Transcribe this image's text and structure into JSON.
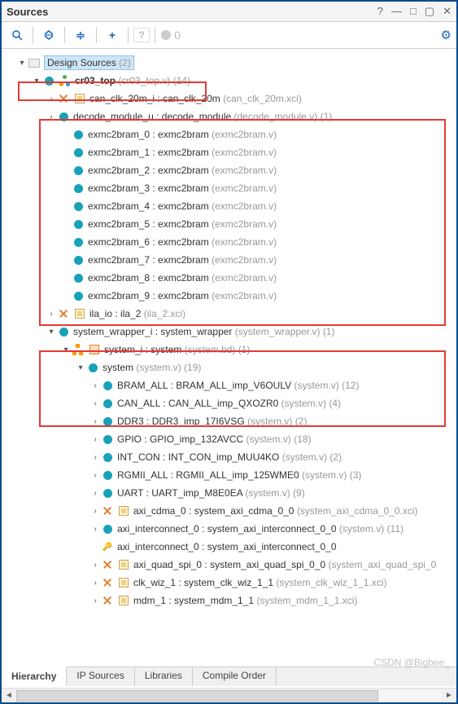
{
  "window": {
    "title": "Sources"
  },
  "toolbar": {
    "counter": "0"
  },
  "root": {
    "label": "Design Sources",
    "count": "(2)"
  },
  "top": {
    "name": "cr03_top",
    "file": "(cr03_top.v)",
    "count": "(14)"
  },
  "can_clk": {
    "inst": "can_clk_20m_i",
    "mod": "can_clk_20m",
    "file": "(can_clk_20m.xci)"
  },
  "decode": {
    "inst": "decode_module_u",
    "mod": "decode_module",
    "file": "(decode_module.v)",
    "count": "(1)"
  },
  "exmc": [
    {
      "inst": "exmc2bram_0",
      "mod": "exmc2bram",
      "file": "(exmc2bram.v)"
    },
    {
      "inst": "exmc2bram_1",
      "mod": "exmc2bram",
      "file": "(exmc2bram.v)"
    },
    {
      "inst": "exmc2bram_2",
      "mod": "exmc2bram",
      "file": "(exmc2bram.v)"
    },
    {
      "inst": "exmc2bram_3",
      "mod": "exmc2bram",
      "file": "(exmc2bram.v)"
    },
    {
      "inst": "exmc2bram_4",
      "mod": "exmc2bram",
      "file": "(exmc2bram.v)"
    },
    {
      "inst": "exmc2bram_5",
      "mod": "exmc2bram",
      "file": "(exmc2bram.v)"
    },
    {
      "inst": "exmc2bram_6",
      "mod": "exmc2bram",
      "file": "(exmc2bram.v)"
    },
    {
      "inst": "exmc2bram_7",
      "mod": "exmc2bram",
      "file": "(exmc2bram.v)"
    },
    {
      "inst": "exmc2bram_8",
      "mod": "exmc2bram",
      "file": "(exmc2bram.v)"
    },
    {
      "inst": "exmc2bram_9",
      "mod": "exmc2bram",
      "file": "(exmc2bram.v)"
    }
  ],
  "ila": {
    "inst": "ila_io",
    "mod": "ila_2",
    "file": "(ila_2.xci)"
  },
  "sys_wrap": {
    "inst": "system_wrapper_i",
    "mod": "system_wrapper",
    "file": "(system_wrapper.v)",
    "count": "(1)"
  },
  "sys_i": {
    "inst": "system_i",
    "mod": "system",
    "file": "(system.bd)",
    "count": "(1)"
  },
  "system": {
    "name": "system",
    "file": "(system.v)",
    "count": "(19)"
  },
  "sysitems": [
    {
      "inst": "BRAM_ALL",
      "mod": "BRAM_ALL_imp_V6OULV",
      "file": "(system.v)",
      "count": "(12)",
      "icon": "teal",
      "arrow": "right"
    },
    {
      "inst": "CAN_ALL",
      "mod": "CAN_ALL_imp_QXOZR0",
      "file": "(system.v)",
      "count": "(4)",
      "icon": "teal",
      "arrow": "right"
    },
    {
      "inst": "DDR3",
      "mod": "DDR3_imp_17I6VSG",
      "file": "(system.v)",
      "count": "(2)",
      "icon": "teal",
      "arrow": "right"
    },
    {
      "inst": "GPIO",
      "mod": "GPIO_imp_132AVCC",
      "file": "(system.v)",
      "count": "(18)",
      "icon": "teal",
      "arrow": "right"
    },
    {
      "inst": "INT_CON",
      "mod": "INT_CON_imp_MUU4KO",
      "file": "(system.v)",
      "count": "(2)",
      "icon": "teal",
      "arrow": "right"
    },
    {
      "inst": "RGMII_ALL",
      "mod": "RGMII_ALL_imp_125WME0",
      "file": "(system.v)",
      "count": "(3)",
      "icon": "teal",
      "arrow": "right"
    },
    {
      "inst": "UART",
      "mod": "UART_imp_M8E0EA",
      "file": "(system.v)",
      "count": "(9)",
      "icon": "teal",
      "arrow": "right"
    },
    {
      "inst": "axi_cdma_0",
      "mod": "system_axi_cdma_0_0",
      "file": "(system_axi_cdma_0_0.xci)",
      "count": "",
      "icon": "ip",
      "arrow": "right",
      "miss": true
    },
    {
      "inst": "axi_interconnect_0",
      "mod": "system_axi_interconnect_0_0",
      "file": "(system.v)",
      "count": "(11)",
      "icon": "teal",
      "arrow": "right"
    },
    {
      "inst": "axi_interconnect_0",
      "mod": "system_axi_interconnect_0_0",
      "file": "",
      "count": "",
      "icon": "key",
      "arrow": "none"
    },
    {
      "inst": "axi_quad_spi_0",
      "mod": "system_axi_quad_spi_0_0",
      "file": "(system_axi_quad_spi_0",
      "count": "",
      "icon": "ip",
      "arrow": "right",
      "miss": true
    },
    {
      "inst": "clk_wiz_1",
      "mod": "system_clk_wiz_1_1",
      "file": "(system_clk_wiz_1_1.xci)",
      "count": "",
      "icon": "ip",
      "arrow": "right",
      "miss": true
    },
    {
      "inst": "mdm_1",
      "mod": "system_mdm_1_1",
      "file": "(system_mdm_1_1.xci)",
      "count": "",
      "icon": "ip",
      "arrow": "right",
      "miss": true
    }
  ],
  "tabs": {
    "t1": "Hierarchy",
    "t2": "IP Sources",
    "t3": "Libraries",
    "t4": "Compile Order"
  },
  "watermark": "CSDN @Bigbee_"
}
